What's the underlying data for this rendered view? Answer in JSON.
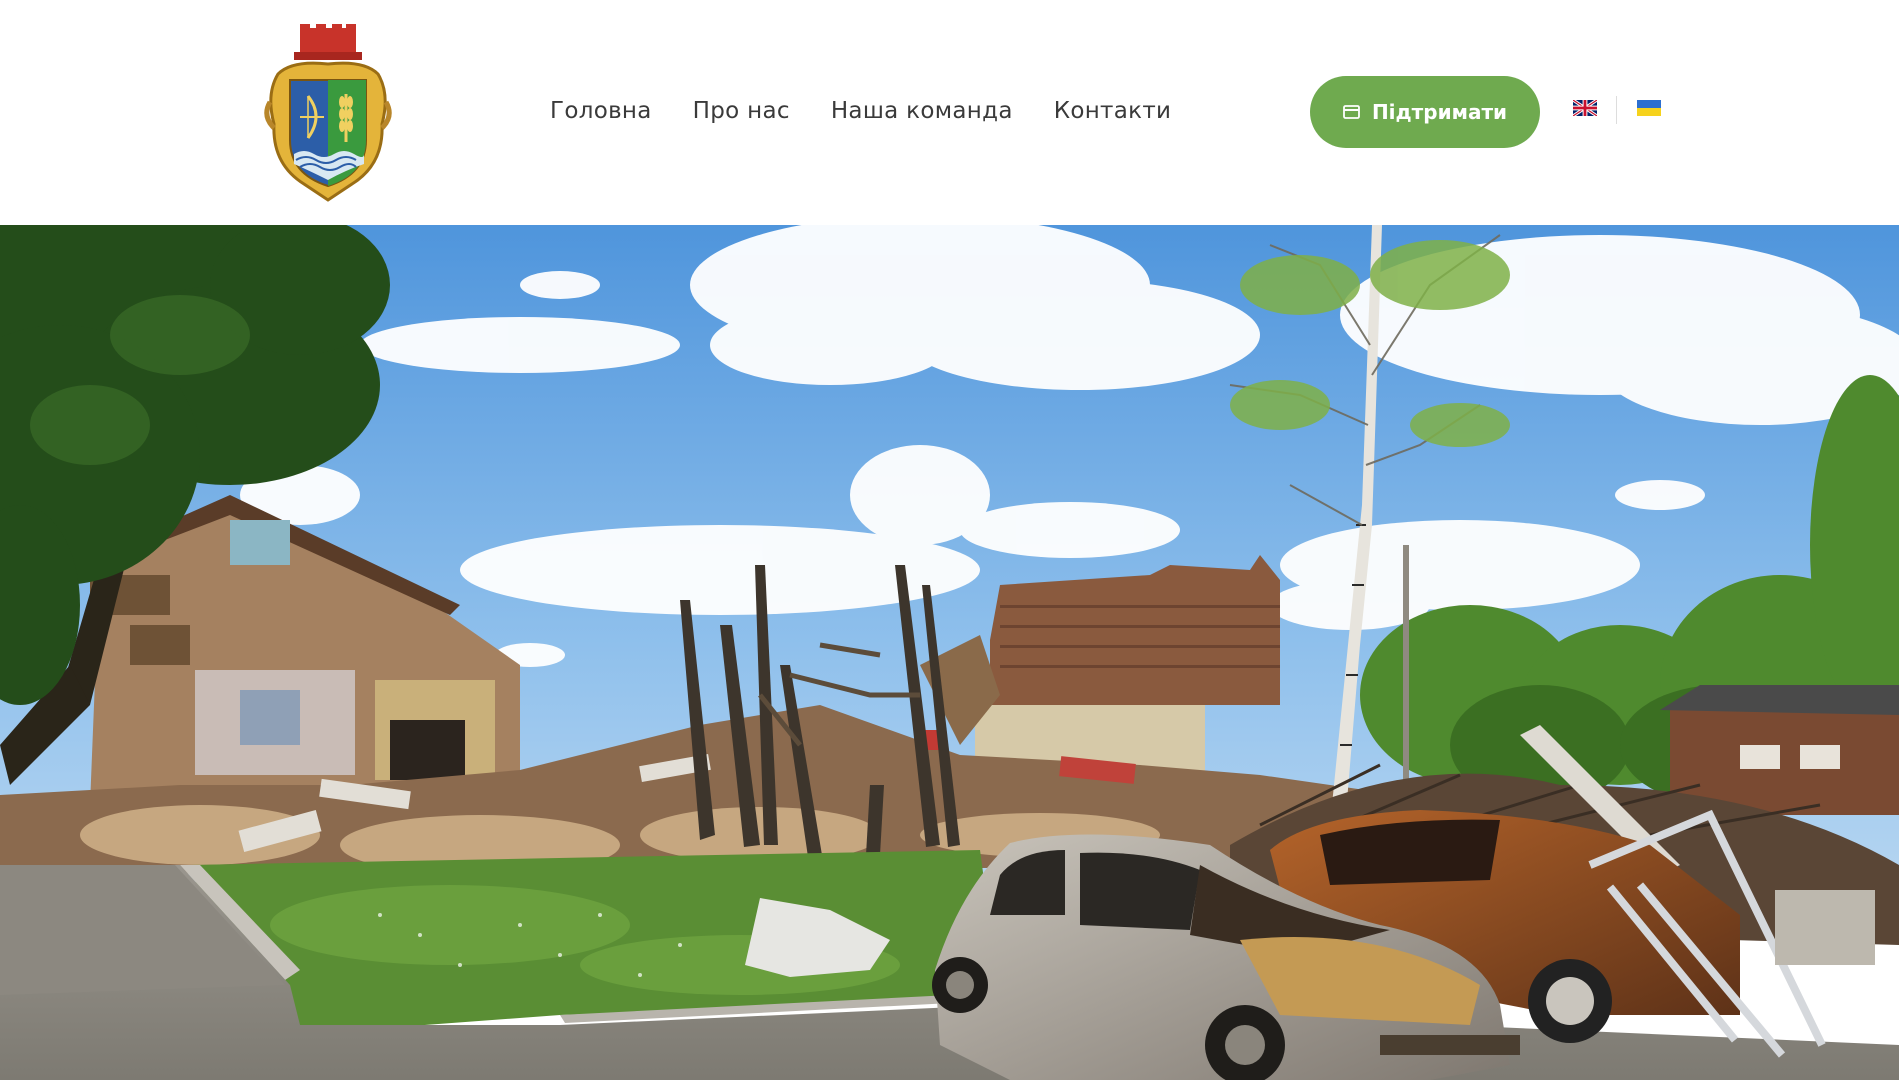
{
  "header": {
    "logo_icon": "coat-of-arms-icon",
    "nav": [
      {
        "label": "Головна"
      },
      {
        "label": "Про нас"
      },
      {
        "label": "Наша команда"
      },
      {
        "label": "Контакти"
      }
    ],
    "support_button": {
      "label": "Підтримати",
      "icon": "credit-card-icon"
    },
    "languages": [
      {
        "code": "en",
        "icon": "uk-flag-icon"
      },
      {
        "code": "uk",
        "icon": "ukraine-flag-icon"
      }
    ]
  },
  "hero": {
    "image": "destroyed-buildings-and-burnt-cars-photo"
  },
  "colors": {
    "accent": "#6faa4f",
    "nav_text": "#3a3a3a",
    "sky": "#5c9fe0"
  }
}
